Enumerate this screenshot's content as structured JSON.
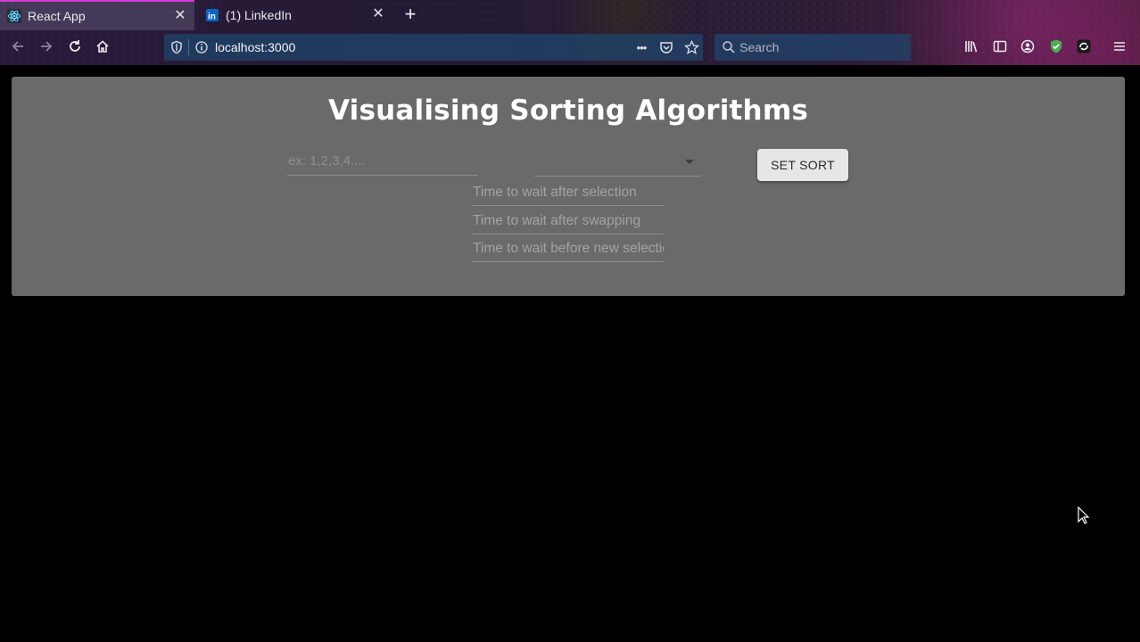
{
  "browser": {
    "tabs": [
      {
        "title": "React App",
        "active": true,
        "icon": "react-icon"
      },
      {
        "title": "(1) LinkedIn",
        "active": false,
        "icon": "linkedin-icon"
      }
    ],
    "new_tab_label": "+",
    "close_label": "✕",
    "url": "localhost:3000",
    "url_actions_label": "•••",
    "search_placeholder": "Search",
    "accent_color": "#d43ad6"
  },
  "app": {
    "title": "Visualising Sorting Algorithms",
    "array_input": {
      "placeholder": "ex: 1,2,3,4....",
      "value": ""
    },
    "algorithm_select": {
      "value": ""
    },
    "set_sort_label": "SET SORT",
    "timing_fields": [
      {
        "placeholder": "Time to wait after selection",
        "value": ""
      },
      {
        "placeholder": "Time to wait after swapping",
        "value": ""
      },
      {
        "placeholder": "Time to wait before new selection",
        "value": ""
      }
    ],
    "panel_color": "#6a6a6a"
  }
}
